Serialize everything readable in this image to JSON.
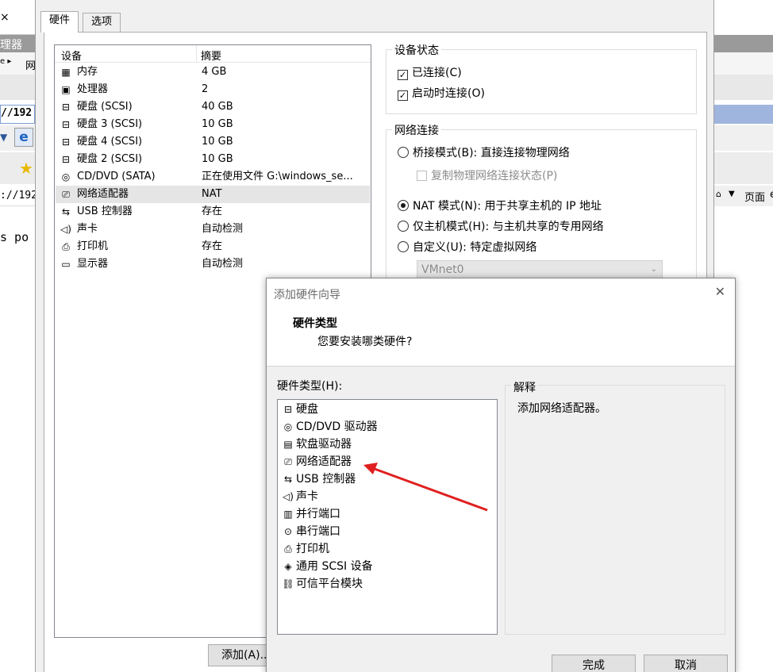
{
  "background": {
    "close_glyph": "×",
    "title_fragment": "理器",
    "menu_fragment": "网",
    "address_fragment": "//192",
    "address_fragment2": "://192",
    "ie_glyph": "e",
    "text_fragment": "s po",
    "right_page_label": "页面",
    "right_text": "e"
  },
  "dialog": {
    "tabs": [
      {
        "label": "硬件"
      },
      {
        "label": "选项"
      }
    ],
    "device_list": {
      "headers": {
        "device": "设备",
        "summary": "摘要"
      },
      "rows": [
        {
          "name": "内存",
          "summary": "4 GB",
          "icon": "memory-icon",
          "glyph": "▦"
        },
        {
          "name": "处理器",
          "summary": "2",
          "icon": "cpu-icon",
          "glyph": "▣"
        },
        {
          "name": "硬盘 (SCSI)",
          "summary": "40 GB",
          "icon": "disk-icon",
          "glyph": "⊟"
        },
        {
          "name": "硬盘 3 (SCSI)",
          "summary": "10 GB",
          "icon": "disk-icon",
          "glyph": "⊟"
        },
        {
          "name": "硬盘 4 (SCSI)",
          "summary": "10 GB",
          "icon": "disk-icon",
          "glyph": "⊟"
        },
        {
          "name": "硬盘 2 (SCSI)",
          "summary": "10 GB",
          "icon": "disk-icon",
          "glyph": "⊟"
        },
        {
          "name": "CD/DVD (SATA)",
          "summary": "正在使用文件 G:\\windows_se...",
          "icon": "cd-icon",
          "glyph": "◎"
        },
        {
          "name": "网络适配器",
          "summary": "NAT",
          "icon": "network-icon",
          "glyph": "⎚"
        },
        {
          "name": "USB 控制器",
          "summary": "存在",
          "icon": "usb-icon",
          "glyph": "⇆"
        },
        {
          "name": "声卡",
          "summary": "自动检测",
          "icon": "sound-icon",
          "glyph": "◁)"
        },
        {
          "name": "打印机",
          "summary": "存在",
          "icon": "printer-icon",
          "glyph": "⎙"
        },
        {
          "name": "显示器",
          "summary": "自动检测",
          "icon": "monitor-icon",
          "glyph": "▭"
        }
      ],
      "selected_index": 7
    },
    "device_status": {
      "legend": "设备状态",
      "connected": "已连接(C)",
      "connect_on_start": "启动时连接(O)",
      "check_glyph": "✓"
    },
    "network_connection": {
      "legend": "网络连接",
      "bridged": "桥接模式(B): 直接连接物理网络",
      "replicate": "复制物理网络连接状态(P)",
      "nat": "NAT 模式(N): 用于共享主机的 IP 地址",
      "host_only": "仅主机模式(H): 与主机共享的专用网络",
      "custom": "自定义(U): 特定虚拟网络",
      "vmnet_value": "VMnet0",
      "selected": "nat"
    },
    "add_button": "添加(A)..."
  },
  "wizard": {
    "title": "添加硬件向导",
    "close_glyph": "✕",
    "heading": "硬件类型",
    "subheading": "您要安装哪类硬件?",
    "list_label": "硬件类型(H):",
    "items": [
      {
        "name": "硬盘",
        "icon": "disk-icon",
        "glyph": "⊟"
      },
      {
        "name": "CD/DVD 驱动器",
        "icon": "cd-icon",
        "glyph": "◎"
      },
      {
        "name": "软盘驱动器",
        "icon": "floppy-icon",
        "glyph": "▤"
      },
      {
        "name": "网络适配器",
        "icon": "network-icon",
        "glyph": "⎚"
      },
      {
        "name": "USB 控制器",
        "icon": "usb-icon",
        "glyph": "⇆"
      },
      {
        "name": "声卡",
        "icon": "sound-icon",
        "glyph": "◁)"
      },
      {
        "name": "并行端口",
        "icon": "parallel-port-icon",
        "glyph": "▥"
      },
      {
        "name": "串行端口",
        "icon": "serial-port-icon",
        "glyph": "⊙"
      },
      {
        "name": "打印机",
        "icon": "printer-icon",
        "glyph": "⎙"
      },
      {
        "name": "通用 SCSI 设备",
        "icon": "scsi-icon",
        "glyph": "◈"
      },
      {
        "name": "可信平台模块",
        "icon": "tpm-icon",
        "glyph": "⛓"
      }
    ],
    "explain_legend": "解释",
    "explain_text": "添加网络适配器。",
    "finish_button": "完成",
    "cancel_button": "取消"
  },
  "colors": {
    "annotation_arrow": "#e02020",
    "selection": "#e5e5e5",
    "dialog_bg": "#f0f0f0"
  }
}
